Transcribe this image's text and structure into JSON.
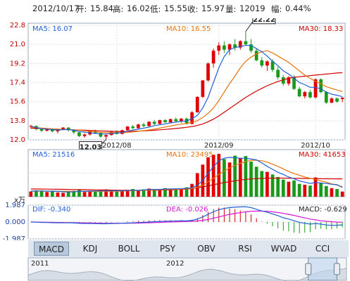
{
  "header": {
    "date": "2012/10/17",
    "open_label": "开:",
    "open": "15.84",
    "high_label": "高:",
    "high": "16.02",
    "low_label": "低:",
    "low": "15.55",
    "close_label": "收:",
    "close": "15.97",
    "volume_label": "量:",
    "volume": "12019",
    "change_label": "幅:",
    "change": "0.44%"
  },
  "chart_data": [
    {
      "type": "candlestick",
      "title": "",
      "ylim": [
        12.0,
        23.0
      ],
      "ytick_labels": [
        "22.8",
        "21.0",
        "19.2",
        "17.4",
        "15.6",
        "13.8",
        "12.0"
      ],
      "xtick_labels": [
        "2012/08",
        "2012/09",
        "2012/10"
      ],
      "legend": [
        {
          "text": "MA5: 16.07",
          "color": "#1f5fd6"
        },
        {
          "text": "MA10: 16.55",
          "color": "#e8740c"
        },
        {
          "text": "MA30: 18.33",
          "color": "#d10000"
        }
      ],
      "annotations": [
        {
          "text": "22.22",
          "label": "high"
        },
        {
          "text": "12.03",
          "label": "low"
        }
      ],
      "up_color": "#e00000",
      "down_color": "#1a9a1a",
      "candles": [
        [
          13.26,
          13.42,
          13.05,
          13.3
        ],
        [
          13.3,
          13.35,
          12.9,
          13.0
        ],
        [
          13.0,
          13.1,
          12.72,
          12.85
        ],
        [
          12.85,
          13.1,
          12.8,
          13.05
        ],
        [
          13.05,
          13.1,
          12.7,
          12.8
        ],
        [
          12.8,
          13.05,
          12.6,
          12.95
        ],
        [
          12.95,
          13.2,
          12.9,
          13.15
        ],
        [
          13.15,
          13.2,
          12.8,
          12.9
        ],
        [
          12.9,
          13.0,
          12.55,
          12.7
        ],
        [
          12.7,
          12.75,
          12.25,
          12.35
        ],
        [
          12.35,
          12.6,
          12.2,
          12.5
        ],
        [
          12.5,
          12.9,
          12.4,
          12.8
        ],
        [
          12.8,
          12.95,
          12.55,
          12.65
        ],
        [
          12.65,
          12.7,
          12.2,
          12.3
        ],
        [
          12.3,
          12.5,
          12.03,
          12.45
        ],
        [
          12.45,
          12.8,
          12.4,
          12.75
        ],
        [
          12.75,
          12.9,
          12.5,
          12.55
        ],
        [
          12.55,
          12.95,
          12.5,
          12.9
        ],
        [
          12.9,
          13.3,
          12.85,
          13.25
        ],
        [
          13.25,
          13.4,
          13.0,
          13.1
        ],
        [
          13.1,
          13.5,
          13.05,
          13.45
        ],
        [
          13.45,
          13.6,
          13.2,
          13.3
        ],
        [
          13.3,
          13.75,
          13.25,
          13.7
        ],
        [
          13.7,
          13.85,
          13.4,
          13.5
        ],
        [
          13.5,
          13.9,
          13.45,
          13.85
        ],
        [
          13.85,
          13.95,
          13.6,
          13.65
        ],
        [
          13.65,
          14.0,
          13.55,
          13.95
        ],
        [
          13.95,
          14.1,
          13.7,
          13.75
        ],
        [
          13.75,
          14.05,
          13.6,
          14.0
        ],
        [
          14.0,
          14.1,
          13.45,
          13.5
        ],
        [
          13.5,
          14.7,
          13.45,
          14.6
        ],
        [
          14.6,
          16.1,
          14.55,
          16.05
        ],
        [
          16.05,
          17.65,
          15.95,
          17.6
        ],
        [
          17.6,
          19.3,
          17.5,
          19.2
        ],
        [
          19.2,
          20.6,
          18.8,
          20.4
        ],
        [
          20.4,
          21.2,
          20.0,
          20.9
        ],
        [
          20.9,
          21.3,
          20.2,
          20.5
        ],
        [
          20.5,
          21.1,
          20.0,
          21.0
        ],
        [
          21.0,
          21.5,
          20.4,
          20.7
        ],
        [
          20.7,
          21.4,
          20.5,
          21.3
        ],
        [
          21.3,
          22.22,
          20.9,
          21.0
        ],
        [
          21.0,
          21.5,
          20.2,
          20.4
        ],
        [
          20.4,
          20.6,
          19.4,
          19.5
        ],
        [
          19.5,
          19.8,
          18.8,
          19.0
        ],
        [
          19.0,
          19.5,
          18.5,
          19.4
        ],
        [
          19.4,
          19.6,
          18.4,
          18.6
        ],
        [
          18.6,
          18.9,
          17.7,
          17.9
        ],
        [
          17.9,
          18.1,
          17.1,
          17.3
        ],
        [
          17.3,
          18.0,
          17.1,
          17.9
        ],
        [
          17.9,
          18.1,
          16.7,
          16.8
        ],
        [
          16.8,
          17.0,
          16.0,
          16.1
        ],
        [
          16.1,
          16.6,
          15.9,
          16.5
        ],
        [
          16.5,
          16.7,
          15.9,
          16.0
        ],
        [
          16.0,
          17.8,
          15.9,
          17.7
        ],
        [
          17.7,
          17.8,
          16.4,
          16.5
        ],
        [
          16.5,
          16.6,
          15.4,
          15.5
        ],
        [
          15.5,
          16.0,
          15.45,
          15.9
        ],
        [
          15.9,
          16.0,
          15.5,
          15.6
        ],
        [
          15.84,
          16.02,
          15.55,
          15.97
        ]
      ],
      "ma5": [
        13.3,
        13.15,
        13.05,
        13.0,
        12.96,
        12.93,
        12.96,
        12.97,
        12.9,
        12.78,
        12.72,
        12.65,
        12.6,
        12.55,
        12.55,
        12.59,
        12.63,
        12.68,
        12.81,
        12.92,
        13.0,
        13.1,
        13.2,
        13.34,
        13.41,
        13.5,
        13.6,
        13.66,
        13.75,
        13.77,
        14.0,
        14.3,
        15.0,
        16.0,
        17.4,
        18.8,
        19.85,
        20.5,
        20.7,
        20.8,
        20.9,
        20.9,
        20.6,
        20.3,
        19.9,
        19.4,
        19.0,
        18.5,
        18.2,
        17.8,
        17.4,
        17.2,
        16.95,
        16.95,
        16.8,
        16.5,
        16.3,
        16.2,
        16.07
      ],
      "ma10": [
        13.2,
        13.15,
        13.1,
        13.07,
        13.03,
        13.0,
        12.98,
        12.97,
        12.94,
        12.9,
        12.85,
        12.8,
        12.75,
        12.7,
        12.68,
        12.67,
        12.66,
        12.66,
        12.7,
        12.74,
        12.8,
        12.86,
        12.93,
        13.0,
        13.1,
        13.2,
        13.3,
        13.4,
        13.48,
        13.55,
        13.65,
        13.8,
        14.1,
        14.5,
        15.0,
        15.7,
        16.5,
        17.3,
        18.0,
        18.8,
        19.4,
        19.8,
        20.1,
        20.3,
        20.4,
        20.2,
        19.9,
        19.6,
        19.3,
        18.9,
        18.5,
        18.1,
        17.8,
        17.5,
        17.3,
        17.0,
        16.85,
        16.7,
        16.55
      ],
      "ma30": [
        13.1,
        13.08,
        13.06,
        13.04,
        13.02,
        13.0,
        12.98,
        12.96,
        12.94,
        12.92,
        12.9,
        12.88,
        12.86,
        12.84,
        12.82,
        12.8,
        12.79,
        12.78,
        12.78,
        12.8,
        12.82,
        12.84,
        12.87,
        12.9,
        12.94,
        12.98,
        13.02,
        13.07,
        13.12,
        13.18,
        13.25,
        13.35,
        13.5,
        13.7,
        13.95,
        14.25,
        14.6,
        14.95,
        15.3,
        15.65,
        16.0,
        16.3,
        16.6,
        16.85,
        17.1,
        17.3,
        17.5,
        17.65,
        17.8,
        17.9,
        17.95,
        18.0,
        18.05,
        18.1,
        18.15,
        18.2,
        18.25,
        18.3,
        18.33
      ]
    },
    {
      "type": "bar",
      "title": "",
      "unit_label": "x万",
      "ylim": [
        0,
        110000
      ],
      "legend": [
        {
          "text": "MA5: 21516",
          "color": "#1f5fd6"
        },
        {
          "text": "MA10: 23495",
          "color": "#e8740c"
        },
        {
          "text": "MA30: 41653",
          "color": "#d10000"
        }
      ],
      "volumes": [
        12000,
        15000,
        14000,
        11000,
        13000,
        10000,
        9000,
        12000,
        14000,
        16000,
        11000,
        13000,
        12000,
        15000,
        17000,
        14000,
        12000,
        13000,
        16000,
        18000,
        15000,
        17000,
        19000,
        16000,
        18000,
        20000,
        17000,
        19000,
        18000,
        22000,
        30000,
        55000,
        75000,
        92000,
        98000,
        100000,
        88000,
        80000,
        96000,
        90000,
        95000,
        82000,
        70000,
        60000,
        58000,
        52000,
        46000,
        40000,
        35000,
        38000,
        30000,
        28000,
        26000,
        45000,
        32000,
        25000,
        20000,
        18000,
        12019
      ],
      "ma5": [
        13000,
        13500,
        13500,
        13000,
        13000,
        12500,
        11500,
        11000,
        11500,
        12500,
        12500,
        13200,
        13500,
        13600,
        13600,
        14200,
        14000,
        14000,
        14500,
        14700,
        14800,
        15800,
        16800,
        17000,
        17000,
        18000,
        18000,
        18500,
        18500,
        19500,
        21000,
        27000,
        38000,
        55000,
        70000,
        84000,
        90000,
        92000,
        91000,
        90000,
        90000,
        88000,
        86000,
        79000,
        71000,
        64000,
        57000,
        52000,
        46000,
        42000,
        37000,
        34000,
        31000,
        33000,
        32000,
        31000,
        29000,
        28000,
        21516
      ],
      "ma10": [
        13000,
        13200,
        13300,
        13200,
        13100,
        12900,
        12600,
        12400,
        12300,
        12300,
        12300,
        12300,
        12400,
        12500,
        12600,
        12800,
        13000,
        13200,
        13600,
        14000,
        14300,
        14700,
        15300,
        15700,
        16000,
        16500,
        17000,
        17300,
        17600,
        18200,
        19500,
        22000,
        27000,
        35000,
        43000,
        52000,
        60000,
        67000,
        73000,
        78000,
        82000,
        85000,
        85000,
        84000,
        81000,
        76000,
        71000,
        65000,
        59000,
        54000,
        50000,
        46000,
        43000,
        40000,
        37000,
        34000,
        30000,
        27000,
        23495
      ],
      "ma30": [
        18000,
        18000,
        17900,
        17800,
        17600,
        17400,
        17200,
        17000,
        16800,
        16600,
        16400,
        16200,
        16000,
        15800,
        15600,
        15400,
        15200,
        15000,
        14900,
        14800,
        14800,
        14900,
        15000,
        15200,
        15400,
        15700,
        16000,
        16500,
        17000,
        17800,
        19000,
        21000,
        23000,
        25500,
        28000,
        30500,
        33000,
        35000,
        37000,
        39000,
        40500,
        41500,
        42200,
        42800,
        43200,
        43400,
        43500,
        43500,
        43300,
        43000,
        42800,
        42600,
        42400,
        42200,
        42100,
        41900,
        41800,
        41700,
        41653
      ]
    },
    {
      "type": "line",
      "title": "",
      "ylim": [
        -1.987,
        1.987
      ],
      "ytick_labels": [
        "1.987",
        "0.000",
        "-1.987"
      ],
      "legend": [
        {
          "text": "DIF: -0.340",
          "color": "#1f5fd6"
        },
        {
          "text": "DEA: -0.026",
          "color": "#d616d6"
        },
        {
          "text": "MACD: -0.629",
          "color": "#222222"
        }
      ],
      "dif": [
        0.0,
        -0.02,
        -0.05,
        -0.06,
        -0.08,
        -0.1,
        -0.1,
        -0.1,
        -0.12,
        -0.16,
        -0.18,
        -0.18,
        -0.19,
        -0.21,
        -0.21,
        -0.19,
        -0.18,
        -0.16,
        -0.12,
        -0.1,
        -0.06,
        -0.04,
        0.0,
        0.03,
        0.06,
        0.08,
        0.11,
        0.12,
        0.15,
        0.13,
        0.2,
        0.35,
        0.6,
        0.9,
        1.2,
        1.45,
        1.6,
        1.7,
        1.75,
        1.78,
        1.8,
        1.7,
        1.5,
        1.3,
        1.15,
        0.95,
        0.75,
        0.5,
        0.35,
        0.15,
        -0.05,
        -0.15,
        -0.25,
        -0.18,
        -0.25,
        -0.35,
        -0.4,
        -0.38,
        -0.34
      ],
      "dea": [
        0.0,
        -0.01,
        -0.02,
        -0.03,
        -0.04,
        -0.05,
        -0.06,
        -0.07,
        -0.08,
        -0.09,
        -0.11,
        -0.12,
        -0.13,
        -0.14,
        -0.15,
        -0.16,
        -0.16,
        -0.16,
        -0.15,
        -0.14,
        -0.13,
        -0.11,
        -0.09,
        -0.07,
        -0.05,
        -0.02,
        0.0,
        0.02,
        0.04,
        0.06,
        0.08,
        0.12,
        0.2,
        0.3,
        0.45,
        0.6,
        0.75,
        0.9,
        1.0,
        1.1,
        1.2,
        1.25,
        1.28,
        1.28,
        1.25,
        1.2,
        1.12,
        1.02,
        0.9,
        0.78,
        0.62,
        0.48,
        0.35,
        0.25,
        0.15,
        0.08,
        0.03,
        -0.01,
        -0.026
      ],
      "macd_bars": [
        0.0,
        -0.02,
        -0.06,
        -0.06,
        -0.08,
        -0.1,
        -0.08,
        -0.06,
        -0.08,
        -0.14,
        -0.14,
        -0.12,
        -0.12,
        -0.14,
        -0.12,
        -0.06,
        -0.04,
        0.0,
        0.06,
        0.08,
        0.14,
        0.14,
        0.18,
        0.2,
        0.22,
        0.2,
        0.22,
        0.2,
        0.22,
        0.14,
        0.24,
        0.46,
        0.8,
        1.2,
        1.5,
        1.7,
        1.7,
        1.6,
        1.5,
        1.36,
        1.2,
        0.9,
        0.44,
        0.04,
        -0.2,
        -0.5,
        -0.74,
        -1.04,
        -1.1,
        -1.26,
        -1.34,
        -1.26,
        -1.2,
        -0.86,
        -0.8,
        -0.86,
        -0.86,
        -0.74,
        -0.629
      ]
    }
  ],
  "tabs": [
    "MACD",
    "KDJ",
    "BOLL",
    "PSY",
    "OBV",
    "RSI",
    "WVAD",
    "CCI"
  ],
  "active_tab": "MACD",
  "navigator": {
    "years": [
      "2011",
      "2012"
    ],
    "range": [
      0.88,
      0.97
    ]
  }
}
